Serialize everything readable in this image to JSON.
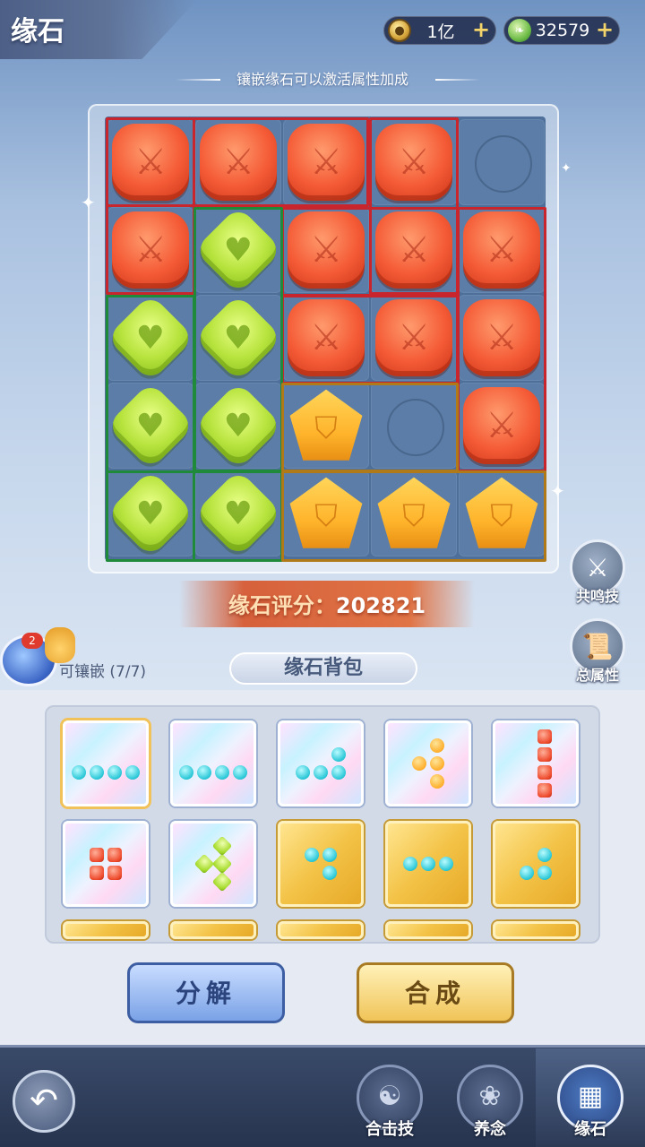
{
  "header": {
    "title": "缘石",
    "currencies": [
      {
        "icon": "coin-icon",
        "value": "1亿"
      },
      {
        "icon": "jade-leaf-icon",
        "value": "32579"
      }
    ],
    "hint": "镶嵌缘石可以激活属性加成"
  },
  "board": {
    "rows": [
      [
        "red",
        "red",
        "red",
        "red",
        "empty"
      ],
      [
        "red",
        "green",
        "red",
        "red",
        "red"
      ],
      [
        "green",
        "green",
        "red",
        "red",
        "red"
      ],
      [
        "green",
        "green",
        "orange",
        "empty",
        "red"
      ],
      [
        "green",
        "green",
        "orange",
        "orange",
        "orange"
      ]
    ],
    "colors": {
      "red_group": "#c8262c",
      "green_group": "#1f8a3a",
      "orange_group": "#b07a18"
    }
  },
  "score": {
    "label": "缘石评分：",
    "value": "202821"
  },
  "side_buttons": [
    {
      "label": "共鸣技",
      "icon": "resonance-skill-icon"
    },
    {
      "label": "总属性",
      "icon": "total-attributes-scroll-icon"
    }
  ],
  "inlay": {
    "label": "可镶嵌 (7/7)",
    "badge": "2"
  },
  "bag": {
    "tab_label": "缘石背包",
    "items": [
      {
        "frame": "holo",
        "stone": "cyan",
        "selected": true
      },
      {
        "frame": "holo",
        "stone": "cyan"
      },
      {
        "frame": "holo",
        "stone": "cyan"
      },
      {
        "frame": "holo",
        "stone": "orange"
      },
      {
        "frame": "holo",
        "stone": "red"
      },
      {
        "frame": "holo",
        "stone": "red"
      },
      {
        "frame": "holo",
        "stone": "green"
      },
      {
        "frame": "gold",
        "stone": "cyan"
      },
      {
        "frame": "gold",
        "stone": "cyan"
      },
      {
        "frame": "gold",
        "stone": "cyan"
      }
    ]
  },
  "actions": {
    "decompose": "分解",
    "synthesize": "合成"
  },
  "nav": {
    "back_icon": "back-arrow-icon",
    "tabs": [
      {
        "label": "合击技",
        "icon": "combo-skill-icon",
        "active": false
      },
      {
        "label": "养念",
        "icon": "lotus-icon",
        "active": false
      },
      {
        "label": "缘石",
        "icon": "stone-grid-icon",
        "active": true
      }
    ]
  }
}
